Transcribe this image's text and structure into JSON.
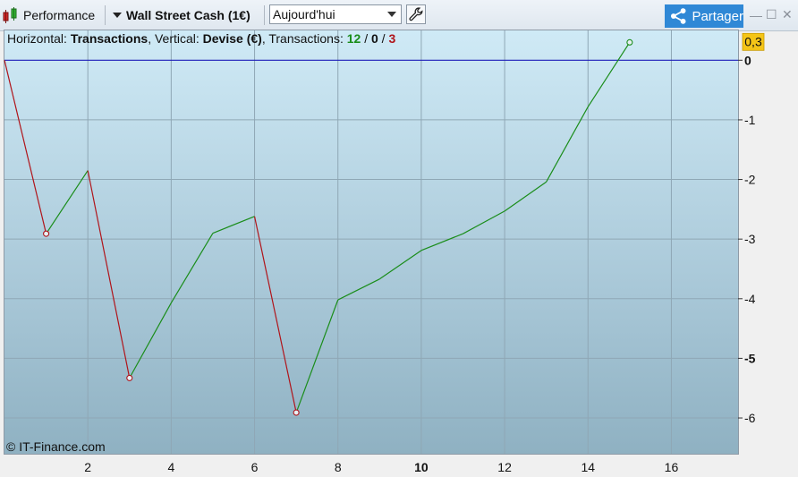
{
  "toolbar": {
    "performance_label": "Performance",
    "instrument_label": "Wall Street Cash (1€)",
    "period_value": "Aujourd'hui",
    "share_label": "Partager"
  },
  "info": {
    "h_label": "Horizontal: ",
    "h_value": "Transactions",
    "v_label": ", Vertical: ",
    "v_value": "Devise (€)",
    "t_label": ", Transactions: ",
    "wins": "12",
    "slash1": " / ",
    "neutral": "0",
    "slash2": " / ",
    "losses": "3"
  },
  "credit": "© IT-Finance.com",
  "colors": {
    "gain": "#1a8d1a",
    "loss": "#b0141a",
    "zero_line": "#1c1cb8",
    "last_badge": "#f5c518"
  },
  "chart_data": {
    "type": "line",
    "xlabel": "",
    "ylabel": "",
    "xlim": [
      0,
      17.6
    ],
    "ylim": [
      -6.6,
      0.5
    ],
    "x_ticks": [
      "2",
      "4",
      "6",
      "8",
      "10",
      "12",
      "14",
      "16"
    ],
    "x_bold_tick": "10",
    "y_ticks": [
      "0",
      "-1",
      "-2",
      "-3",
      "-4",
      "-5",
      "-6"
    ],
    "y_bold_tick": "-5",
    "last_value_label": "0,3",
    "series": [
      {
        "points": [
          {
            "x": 0,
            "y": 0
          },
          {
            "x": 1,
            "y": -2.91
          },
          {
            "x": 2,
            "y": -1.85
          },
          {
            "x": 3,
            "y": -5.33
          },
          {
            "x": 4,
            "y": -4.07
          },
          {
            "x": 5,
            "y": -2.9
          },
          {
            "x": 6,
            "y": -2.62
          },
          {
            "x": 7,
            "y": -5.91
          },
          {
            "x": 8,
            "y": -4.02
          },
          {
            "x": 9,
            "y": -3.67
          },
          {
            "x": 10,
            "y": -3.19
          },
          {
            "x": 11,
            "y": -2.91
          },
          {
            "x": 12,
            "y": -2.53
          },
          {
            "x": 13,
            "y": -2.04
          },
          {
            "x": 14,
            "y": -0.78
          },
          {
            "x": 15,
            "y": 0.3
          }
        ],
        "markers": [
          1,
          3,
          7,
          15
        ]
      }
    ]
  }
}
